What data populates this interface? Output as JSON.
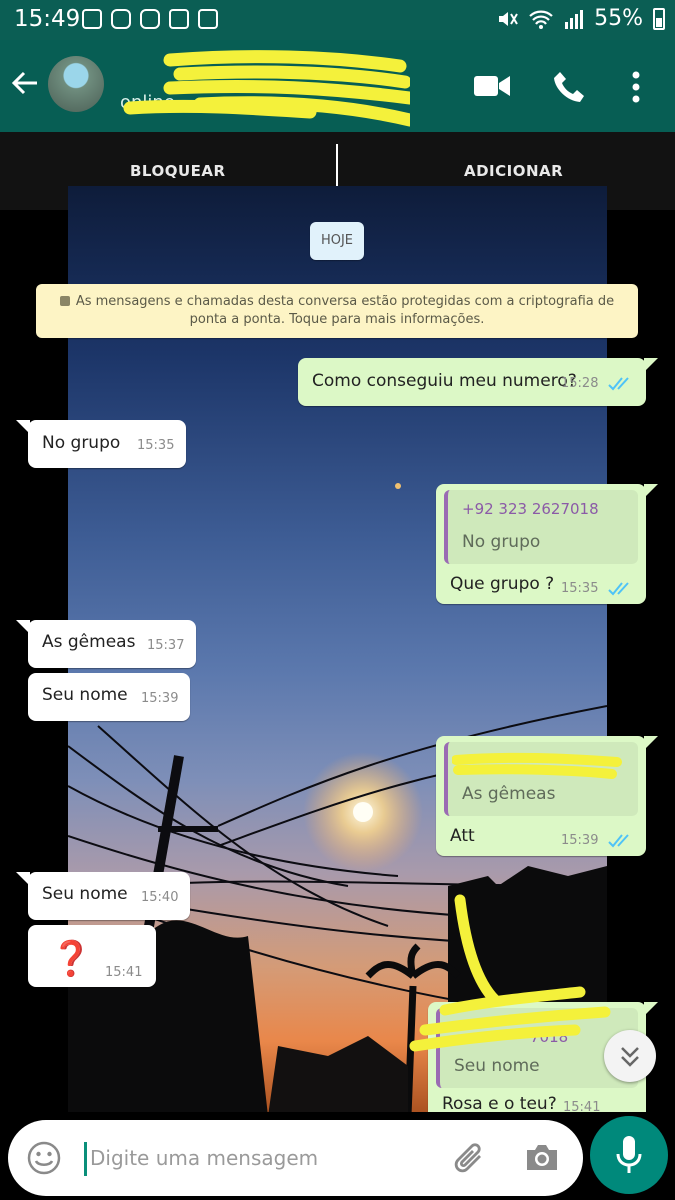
{
  "status_bar": {
    "time": "15:49",
    "battery": "55%"
  },
  "app_bar": {
    "contact_status": "online"
  },
  "actions": {
    "block": "BLOQUEAR",
    "add": "ADICIONAR"
  },
  "chat": {
    "date_chip": "HOJE",
    "encryption_notice": "As mensagens e chamadas desta conversa estão protegidas com a criptografia de ponta a ponta. Toque para mais informações.",
    "messages": [
      {
        "text": "Como conseguiu meu numero?",
        "time": "15:28"
      },
      {
        "text": "No grupo",
        "time": "15:35"
      },
      {
        "quote_name": "+92 323 2627018",
        "quote_text": "No grupo",
        "text": "Que grupo ?",
        "time": "15:35"
      },
      {
        "text": "As gêmeas",
        "time": "15:37"
      },
      {
        "text": "Seu nome",
        "time": "15:39"
      },
      {
        "quote_text": "As gêmeas",
        "text": "Att",
        "time": "15:39"
      },
      {
        "text": "Seu nome",
        "time": "15:40"
      },
      {
        "text": "❓",
        "time": "15:41"
      },
      {
        "quote_name": "7018",
        "quote_text": "Seu nome",
        "text": "Rosa e o teu?",
        "time": "15:41"
      }
    ]
  },
  "composer": {
    "placeholder": "Digite uma mensagem"
  },
  "colors": {
    "header": "#075e54",
    "outgoing_bubble": "#dcf8c6",
    "incoming_bubble": "#ffffff",
    "read_ticks": "#4fc3f7",
    "fab": "#00897b"
  }
}
